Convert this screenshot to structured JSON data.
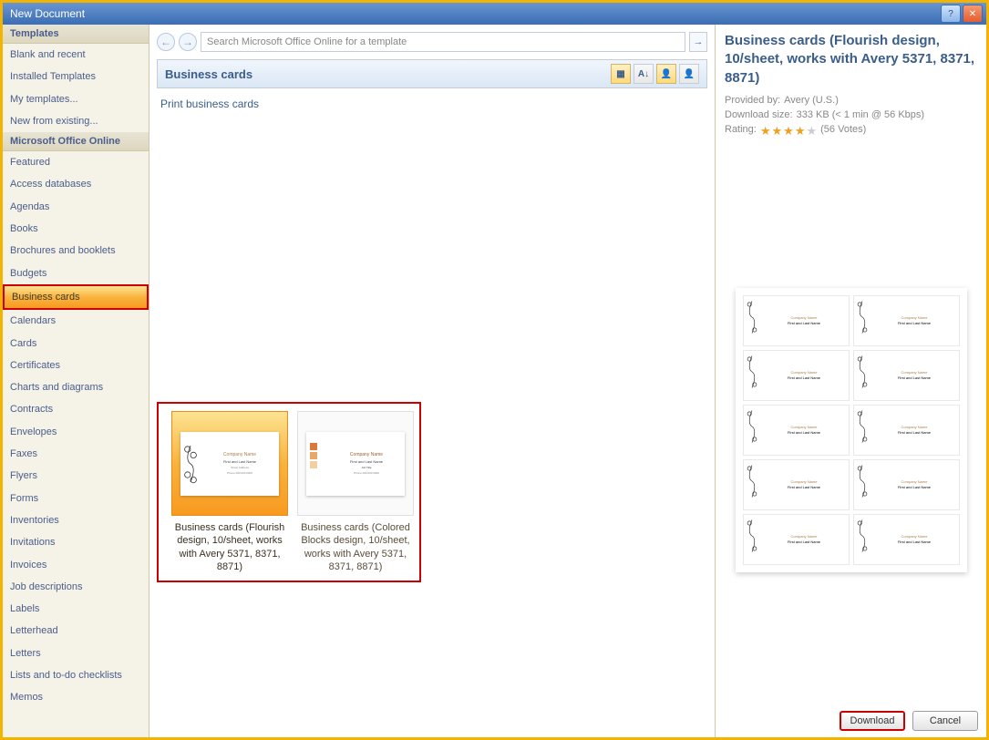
{
  "window": {
    "title": "New Document"
  },
  "sidebar": {
    "section1": "Templates",
    "items1": [
      "Blank and recent",
      "Installed Templates",
      "My templates...",
      "New from existing..."
    ],
    "section2": "Microsoft Office Online",
    "items2": [
      "Featured",
      "Access databases",
      "Agendas",
      "Books",
      "Brochures and booklets",
      "Budgets",
      "Business cards",
      "Calendars",
      "Cards",
      "Certificates",
      "Charts and diagrams",
      "Contracts",
      "Envelopes",
      "Faxes",
      "Flyers",
      "Forms",
      "Inventories",
      "Invitations",
      "Invoices",
      "Job descriptions",
      "Labels",
      "Letterhead",
      "Letters",
      "Lists and to-do checklists",
      "Memos"
    ],
    "selected_index": 6
  },
  "search": {
    "placeholder": "Search Microsoft Office Online for a template"
  },
  "category": {
    "heading": "Business cards",
    "sub": "Print business cards"
  },
  "thumbs": [
    {
      "label": "Business cards (Flourish design, 10/sheet, works with Avery 5371, 8371, 8871)",
      "selected": true
    },
    {
      "label": "Business cards (Colored Blocks design, 10/sheet, works with Avery 5371, 8371, 8871)",
      "selected": false
    }
  ],
  "detail": {
    "title": "Business cards (Flourish design, 10/sheet, works with Avery 5371, 8371, 8871)",
    "provided_label": "Provided by:",
    "provided_val": "Avery (U.S.)",
    "size_label": "Download size:",
    "size_val": "333 KB (< 1 min @ 56 Kbps)",
    "rating_label": "Rating:",
    "votes": "(56 Votes)",
    "stars": 4
  },
  "card_sample": {
    "company": "Company Name",
    "name": "First and Last Name",
    "title": "Job Title"
  },
  "buttons": {
    "download": "Download",
    "cancel": "Cancel"
  }
}
